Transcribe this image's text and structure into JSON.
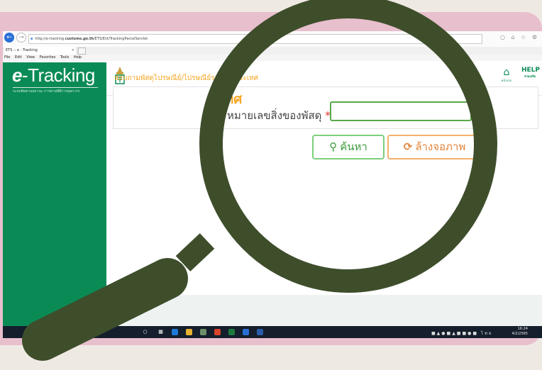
{
  "browser": {
    "url_prefix": "http://e-tracking.",
    "url_domain": "customs.go.th",
    "url_path": "/ETS/Ent/TrackingParcelServlet",
    "tab_title": "ETS :: e - Tracking",
    "menu": [
      "File",
      "Edit",
      "View",
      "Favorites",
      "Tools",
      "Help"
    ]
  },
  "site": {
    "logo_e": "e",
    "logo_rest": "-Tracking",
    "logo_subtitle": "ระบบติดตามสถานะ การผ่านพิธีการศุลกากร",
    "home_label": "หน้าแรก",
    "help_label": "HELP",
    "help_sub": "ช่วยเหลือ"
  },
  "form": {
    "title": "สอบถามพัสดุไปรษณีย์/ไปรษณีย์ระหว่างประเทศ",
    "title_zoomed": "ะเทศ",
    "field_label": "หมายเลขสิ่งของพัสดุ",
    "required_mark": "*",
    "info_icon": "i",
    "search_button": "ค้นหา",
    "clear_button": "ล้างจอภาพ"
  },
  "taskbar": {
    "time": "16:24",
    "date": "4/2/2565",
    "lang": "ไทย"
  },
  "colors": {
    "sidebar": "#0a8b55",
    "title": "#f5a623",
    "magnifier": "#3e4e2b",
    "frame": "#e8bfcd"
  }
}
